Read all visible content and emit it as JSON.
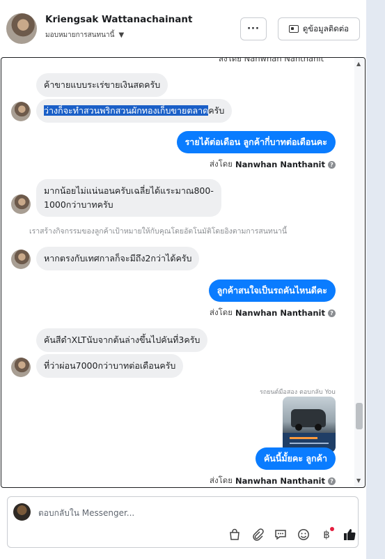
{
  "header": {
    "name": "Kriengsak Wattanachainant",
    "assignment": "มอบหมายการสนทนานี้",
    "more_label": "···",
    "contact_label": "ดูข้อมูลติดต่อ"
  },
  "thread": {
    "top_cut_text": "ส่งโดย Nanwhan Nanthanit",
    "m1": "ค้าขายแบบระเร่ขายเงินสดครับ",
    "m2_highlighted": "ว่างก็จะทำสวนพริกสวนผักทองเก็บขายตลาด",
    "m2_rest": "ครับ",
    "out1": "รายได้ต่อเดือน ลูกค้ากี่บาทต่อเดือนคะ",
    "sentby_prefix": "ส่งโดย",
    "sentby_name": "Nanwhan Nanthanit",
    "m3_line1": "มากน้อยไม่แน่นอนครับเฉลี่ยได้แระมาณ800-",
    "m3_line2": "1000กว่าบาทครับ",
    "notice": "เราสร้างกิจกรรมของลูกค้าเป้าหมายให้กับคุณโดยอัตโนมัติโดยอิงตามการสนทนานี้",
    "m4": "หากตรงกับเทศกาลก็จะมีถึง2กว่าได้ครับ",
    "out2": "ลูกค้าสนใจเป็นรถคันไหนดีคะ",
    "m5": "คันสีดำXLTนับจากต้นล่างขึ้นไปคันที่3ครับ",
    "m6": "ที่ว่าผ่อน7000กว่าบาทต่อเดือนครับ",
    "reply_label": "รถยนต์มือสอง ตอบกลับ You",
    "out3": "คันนี้มั้ยคะ ลูกค้า"
  },
  "composer": {
    "placeholder": "ตอบกลับใน Messenger..."
  },
  "colors": {
    "outgoing_bubble": "#0a7cff",
    "incoming_bubble": "#eeeff1",
    "highlight": "#1a5fc7",
    "badge_red": "#e41e3f"
  },
  "icons": [
    "more-icon",
    "contact-card-icon",
    "bag-icon",
    "attach-icon",
    "saved-reply-icon",
    "emoji-icon",
    "baht-icon",
    "like-icon"
  ]
}
